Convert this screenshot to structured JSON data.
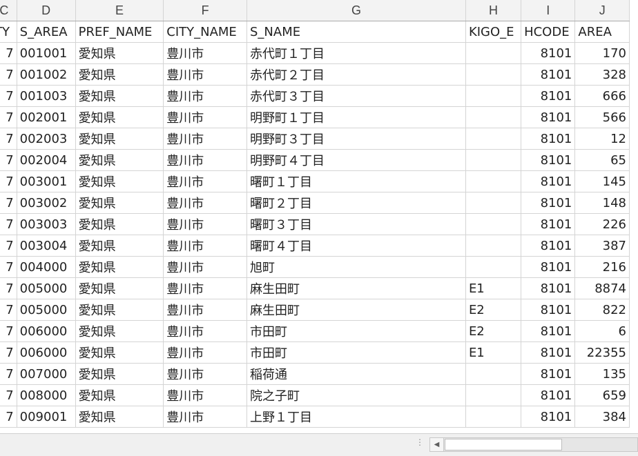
{
  "columns": [
    "C",
    "D",
    "E",
    "F",
    "G",
    "H",
    "I",
    "J"
  ],
  "header": [
    "TY",
    "S_AREA",
    "PREF_NAME",
    "CITY_NAME",
    "S_NAME",
    "KIGO_E",
    "HCODE",
    "AREA"
  ],
  "rows": [
    [
      "7",
      "001001",
      "愛知県",
      "豊川市",
      "赤代町１丁目",
      "",
      "8101",
      "170"
    ],
    [
      "7",
      "001002",
      "愛知県",
      "豊川市",
      "赤代町２丁目",
      "",
      "8101",
      "328"
    ],
    [
      "7",
      "001003",
      "愛知県",
      "豊川市",
      "赤代町３丁目",
      "",
      "8101",
      "666"
    ],
    [
      "7",
      "002001",
      "愛知県",
      "豊川市",
      "明野町１丁目",
      "",
      "8101",
      "566"
    ],
    [
      "7",
      "002003",
      "愛知県",
      "豊川市",
      "明野町３丁目",
      "",
      "8101",
      "12"
    ],
    [
      "7",
      "002004",
      "愛知県",
      "豊川市",
      "明野町４丁目",
      "",
      "8101",
      "65"
    ],
    [
      "7",
      "003001",
      "愛知県",
      "豊川市",
      "曙町１丁目",
      "",
      "8101",
      "145"
    ],
    [
      "7",
      "003002",
      "愛知県",
      "豊川市",
      "曙町２丁目",
      "",
      "8101",
      "148"
    ],
    [
      "7",
      "003003",
      "愛知県",
      "豊川市",
      "曙町３丁目",
      "",
      "8101",
      "226"
    ],
    [
      "7",
      "003004",
      "愛知県",
      "豊川市",
      "曙町４丁目",
      "",
      "8101",
      "387"
    ],
    [
      "7",
      "004000",
      "愛知県",
      "豊川市",
      "旭町",
      "",
      "8101",
      "216"
    ],
    [
      "7",
      "005000",
      "愛知県",
      "豊川市",
      "麻生田町",
      "E1",
      "8101",
      "8874"
    ],
    [
      "7",
      "005000",
      "愛知県",
      "豊川市",
      "麻生田町",
      "E2",
      "8101",
      "822"
    ],
    [
      "7",
      "006000",
      "愛知県",
      "豊川市",
      "市田町",
      "E2",
      "8101",
      "6"
    ],
    [
      "7",
      "006000",
      "愛知県",
      "豊川市",
      "市田町",
      "E1",
      "8101",
      "22355"
    ],
    [
      "7",
      "007000",
      "愛知県",
      "豊川市",
      "稲荷通",
      "",
      "8101",
      "135"
    ],
    [
      "7",
      "008000",
      "愛知県",
      "豊川市",
      "院之子町",
      "",
      "8101",
      "659"
    ],
    [
      "7",
      "009001",
      "愛知県",
      "豊川市",
      "上野１丁目",
      "",
      "8101",
      "384"
    ]
  ],
  "icons": {
    "scroll_left": "scroll-left-arrow-icon",
    "grip": "split-grip-icon"
  }
}
